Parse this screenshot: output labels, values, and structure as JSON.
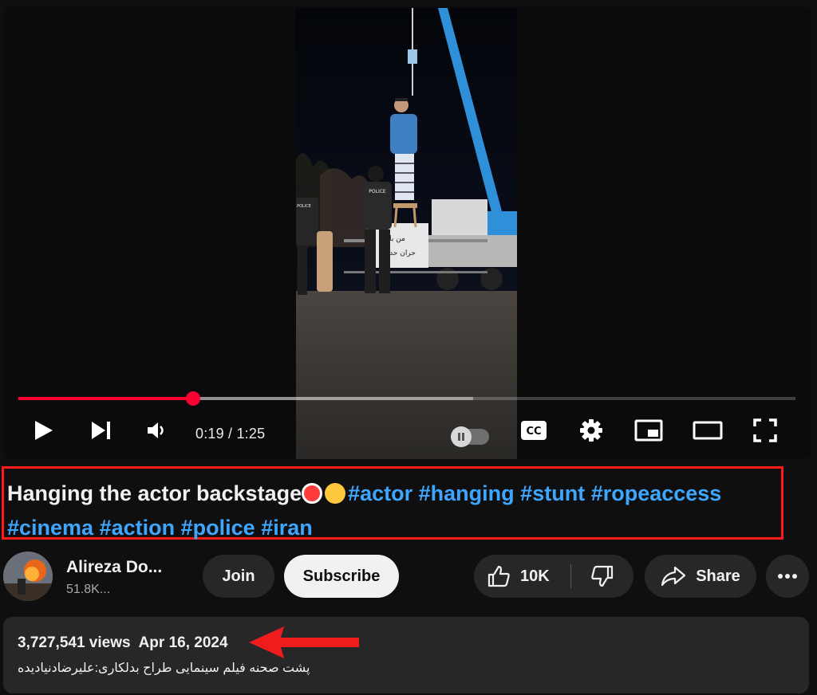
{
  "player": {
    "current_time": "0:19",
    "separator": " / ",
    "duration": "1:25",
    "progress_fraction": 0.225,
    "buffered_fraction": 0.585,
    "controls": [
      "play-icon",
      "next-icon",
      "volume-icon",
      "autoplay-toggle",
      "captions-icon",
      "settings-icon",
      "miniplayer-icon",
      "theater-icon",
      "fullscreen-icon"
    ],
    "captions_label": "CC"
  },
  "scene_text": {
    "police_label": "POLICE",
    "police_label_2": "POLICE",
    "banner_line1": "من با",
    "banner_line2": "حران حدوده"
  },
  "video": {
    "title_text": "Hanging the actor backstage",
    "emojis": [
      "no-under-18-emoji",
      "fearful-face-emoji"
    ],
    "hashtags_line1": [
      "#actor",
      "#hanging",
      "#stunt",
      "#ropeaccess"
    ],
    "hashtags_line2": [
      "#cinema",
      "#action",
      "#police",
      "#iran"
    ]
  },
  "channel": {
    "name": "Alireza Do...",
    "subscribers": "51.8K..."
  },
  "actions": {
    "join_label": "Join",
    "subscribe_label": "Subscribe",
    "like_count": "10K",
    "share_label": "Share"
  },
  "description": {
    "views": "3,727,541 views",
    "date": "Apr 16, 2024",
    "text": "پشت صحنه فیلم سینمایی طراح بدلکاری:علیرضادنیادیده"
  },
  "colors": {
    "background": "#0f0f0f",
    "progress": "#ff0033",
    "hashtag": "#3ea6ff",
    "highlight_box": "#ff1a1a",
    "annotation_arrow": "#ee1c1c",
    "pill_bg": "#272727"
  }
}
